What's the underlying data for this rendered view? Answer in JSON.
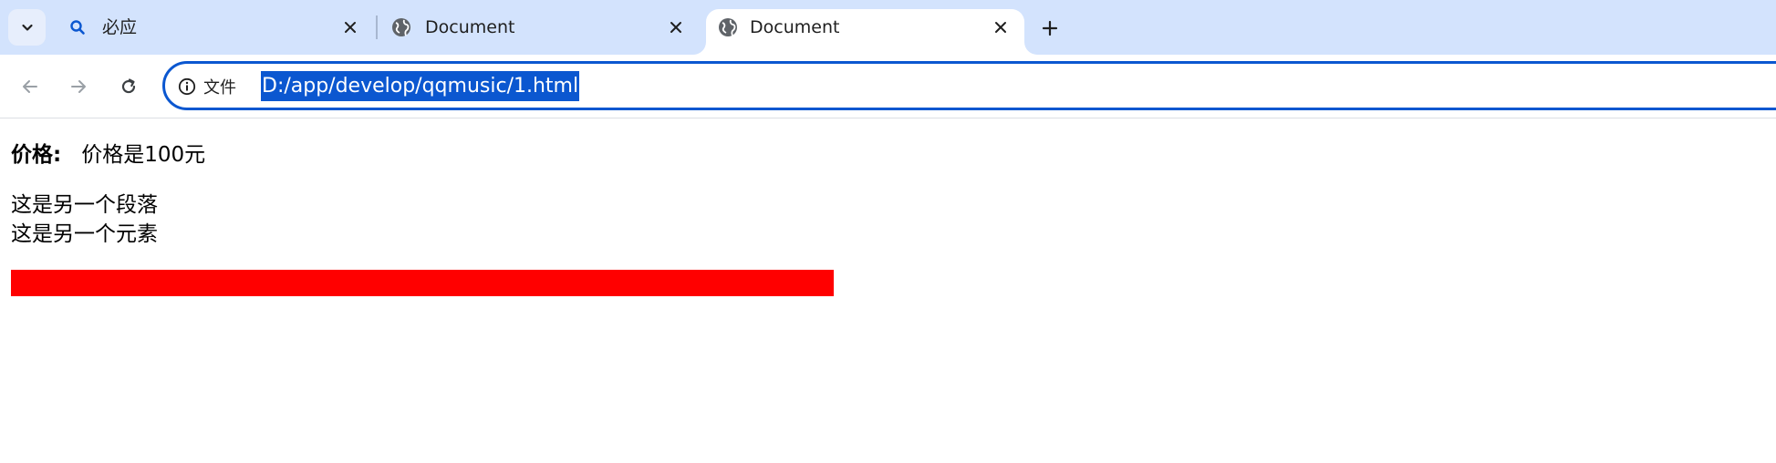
{
  "browser": {
    "tabs": [
      {
        "title": "必应",
        "favicon": "search-icon",
        "active": false
      },
      {
        "title": "Document",
        "favicon": "globe-icon",
        "active": false
      },
      {
        "title": "Document",
        "favicon": "globe-icon",
        "active": true
      }
    ],
    "omnibox": {
      "site_info_label": "文件",
      "url": "D:/app/develop/qqmusic/1.html"
    },
    "colors": {
      "tabstrip": "#d3e3fd",
      "accent": "#0b57d0"
    }
  },
  "page": {
    "price_label": "价格:",
    "price_value": "价格是100元",
    "paragraph": "这是另一个段落",
    "element": "这是另一个元素",
    "bar_color": "#ff0000"
  }
}
